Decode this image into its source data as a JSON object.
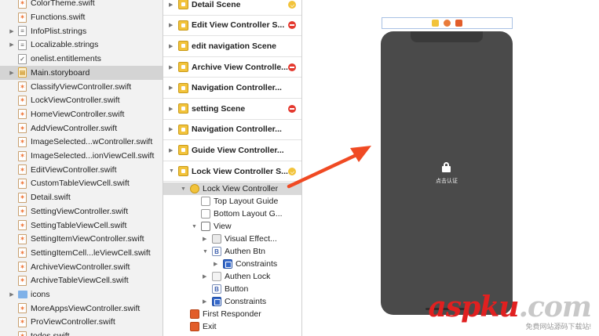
{
  "navigator": {
    "files": [
      {
        "name": "ColorTheme.swift",
        "type": "swift"
      },
      {
        "name": "Functions.swift",
        "type": "swift"
      },
      {
        "name": "InfoPlist.strings",
        "type": "strings",
        "disclosure": "closed"
      },
      {
        "name": "Localizable.strings",
        "type": "strings",
        "disclosure": "closed"
      },
      {
        "name": "onelist.entitlements",
        "type": "entitlements"
      },
      {
        "name": "Main.storyboard",
        "type": "storyboard",
        "disclosure": "closed",
        "selected": true
      },
      {
        "name": "ClassifyViewController.swift",
        "type": "swift"
      },
      {
        "name": "LockViewController.swift",
        "type": "swift"
      },
      {
        "name": "HomeViewController.swift",
        "type": "swift"
      },
      {
        "name": "AddViewController.swift",
        "type": "swift"
      },
      {
        "name": "ImageSelected...wController.swift",
        "type": "swift"
      },
      {
        "name": "ImageSelected...ionViewCell.swift",
        "type": "swift"
      },
      {
        "name": "EditViewController.swift",
        "type": "swift"
      },
      {
        "name": "CustomTableViewCell.swift",
        "type": "swift"
      },
      {
        "name": "Detail.swift",
        "type": "swift"
      },
      {
        "name": "SettingViewController.swift",
        "type": "swift"
      },
      {
        "name": "SettingTableViewCell.swift",
        "type": "swift"
      },
      {
        "name": "SettingItemViewController.swift",
        "type": "swift"
      },
      {
        "name": "SettingItemCell...leViewCell.swift",
        "type": "swift"
      },
      {
        "name": "ArchiveViewController.swift",
        "type": "swift"
      },
      {
        "name": "ArchiveTableViewCell.swift",
        "type": "swift"
      },
      {
        "name": "icons",
        "type": "folder",
        "disclosure": "closed"
      },
      {
        "name": "MoreAppsViewController.swift",
        "type": "swift"
      },
      {
        "name": "ProViewController.swift",
        "type": "swift"
      },
      {
        "name": "todos.swift",
        "type": "swift"
      }
    ]
  },
  "outline": {
    "scenes": [
      {
        "label": "Detail Scene",
        "badge": "yellow"
      },
      {
        "label": "Edit View Controller S...",
        "badge": "red"
      },
      {
        "label": "edit navigation Scene",
        "badge": ""
      },
      {
        "label": "Archive View Controlle...",
        "badge": "red"
      },
      {
        "label": "Navigation Controller...",
        "badge": ""
      },
      {
        "label": "setting Scene",
        "badge": "red"
      },
      {
        "label": "Navigation Controller...",
        "badge": ""
      },
      {
        "label": "Guide View Controller...",
        "badge": ""
      },
      {
        "label": "Lock View Controller S...",
        "badge": "yellow"
      }
    ],
    "tree": [
      {
        "label": "Lock View Controller",
        "icon": "vc",
        "depth": 0,
        "disclosure": "open",
        "selected": true
      },
      {
        "label": "Top Layout Guide",
        "icon": "guide",
        "depth": 1,
        "disclosure": ""
      },
      {
        "label": "Bottom Layout G...",
        "icon": "guide",
        "depth": 1,
        "disclosure": ""
      },
      {
        "label": "View",
        "icon": "view",
        "depth": 1,
        "disclosure": "open"
      },
      {
        "label": "Visual Effect...",
        "icon": "visual",
        "depth": 2,
        "disclosure": "closed"
      },
      {
        "label": "Authen Btn",
        "icon": "btn",
        "depth": 2,
        "disclosure": "open"
      },
      {
        "label": "Constraints",
        "icon": "cons",
        "depth": 3,
        "disclosure": "closed"
      },
      {
        "label": "Authen Lock",
        "icon": "lock",
        "depth": 2,
        "disclosure": "closed"
      },
      {
        "label": "Button",
        "icon": "btn",
        "depth": 2,
        "disclosure": ""
      },
      {
        "label": "Constraints",
        "icon": "cons",
        "depth": 2,
        "disclosure": "closed"
      },
      {
        "label": "First Responder",
        "icon": "resp",
        "depth": 0,
        "disclosure": ""
      },
      {
        "label": "Exit",
        "icon": "exit",
        "depth": 0,
        "disclosure": ""
      }
    ]
  },
  "canvas": {
    "lock_caption": "点击认证"
  },
  "watermark": {
    "main_a": "asp",
    "main_b": "ku",
    "main_c": ".com",
    "sub": "免费网站源码下载站!"
  },
  "colors": {
    "arrow": "#f04a23",
    "accent": "#f2c33b",
    "badge_red": "#e4392f",
    "selection": "#d4d4d4",
    "phone": "#4a4a4a"
  }
}
